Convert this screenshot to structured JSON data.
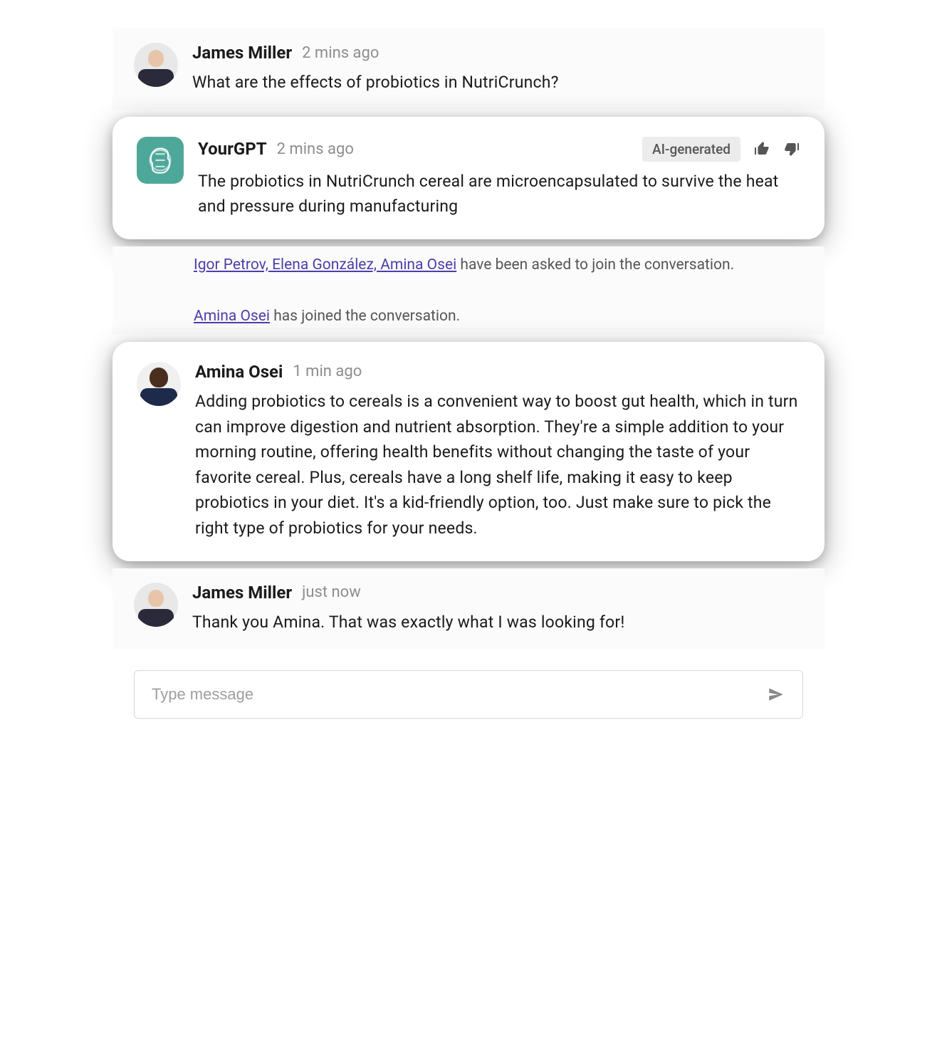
{
  "messages": [
    {
      "author": "James Miller",
      "timestamp": "2 mins ago",
      "text": "What are the effects of probiotics in NutriCrunch?"
    },
    {
      "author": "YourGPT",
      "timestamp": "2 mins ago",
      "badge": "AI-generated",
      "text": "The probiotics in NutriCrunch cereal are microencapsulated to survive the heat and pressure during manufacturing"
    },
    {
      "author": "Amina Osei",
      "timestamp": "1 min ago",
      "text": "Adding probiotics to cereals is a convenient way to boost gut health, which in turn can improve digestion and nutrient absorption. They're a simple addition to your morning routine, offering health benefits without changing the taste of your favorite cereal. Plus, cereals have a long shelf life, making it easy to keep probiotics in your diet. It's a kid-friendly option, too. Just make sure to pick the right type of probiotics for your needs."
    },
    {
      "author": "James Miller",
      "timestamp": "just now",
      "text": "Thank you Amina. That was exactly what I was looking for!"
    }
  ],
  "system": {
    "invite_link": "Igor Petrov, Elena González, Amina Osei",
    "invite_suffix": " have been asked to join the conversation.",
    "join_link": "Amina Osei",
    "join_suffix": " has joined the conversation."
  },
  "input": {
    "placeholder": "Type message"
  }
}
